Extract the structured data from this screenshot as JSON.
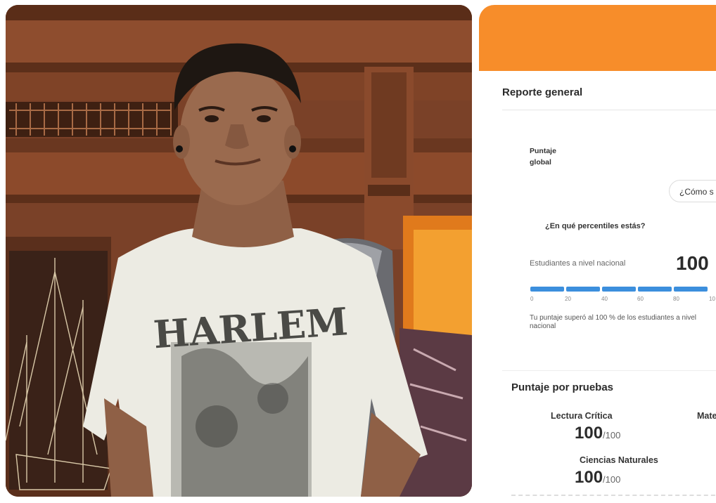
{
  "photo": {
    "shirt_text": "HARLEM",
    "colors": {
      "wood": "#7a4128",
      "shirt": "#ecebe3",
      "skin": "#9a6a4e",
      "hair": "#1e1712",
      "backpack": "#8b8d92"
    }
  },
  "report": {
    "header_color": "#f78d2a",
    "title": "Reporte general",
    "puntaje_global_label": "Puntaje\nglobal",
    "como_button": "¿Cómo s",
    "percentile_question": "¿En qué percentiles estás?",
    "nacional_label": "Estudiantes a nivel nacional",
    "nacional_value": "100",
    "progress": {
      "value_percent": 100,
      "color": "#3c8fdd"
    },
    "ticks": [
      "0",
      "20",
      "40",
      "60",
      "80",
      "10"
    ],
    "note": "Tu puntaje superó al 100 % de los estudiantes a nivel nacional",
    "pruebas_title": "Puntaje por pruebas",
    "subjects": [
      {
        "name": "Lectura Crítica",
        "score": "100",
        "denominator": "/100"
      },
      {
        "name": "Mate",
        "score": "",
        "denominator": ""
      },
      {
        "name": "Ciencias Naturales",
        "score": "100",
        "denominator": "/100"
      }
    ]
  }
}
